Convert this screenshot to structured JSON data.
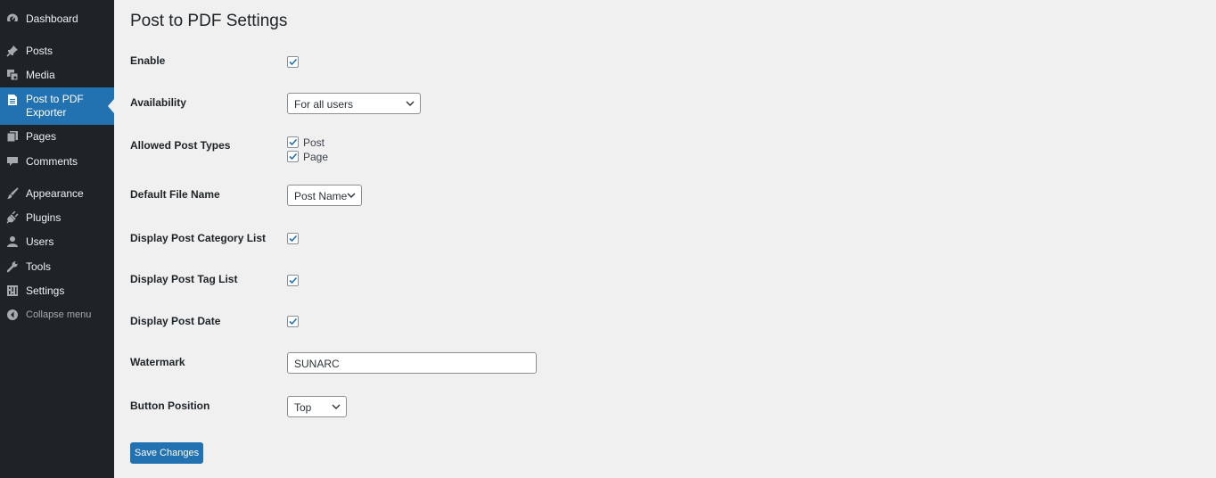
{
  "sidebar": {
    "items": [
      {
        "label": "Dashboard",
        "icon": "dashboard-icon"
      },
      {
        "label": "Posts",
        "icon": "pin-icon"
      },
      {
        "label": "Media",
        "icon": "media-icon"
      },
      {
        "label": "Post to PDF Exporter",
        "icon": "document-icon",
        "active": true
      },
      {
        "label": "Pages",
        "icon": "pages-icon"
      },
      {
        "label": "Comments",
        "icon": "comment-icon"
      },
      {
        "label": "Appearance",
        "icon": "brush-icon"
      },
      {
        "label": "Plugins",
        "icon": "plugin-icon"
      },
      {
        "label": "Users",
        "icon": "user-icon"
      },
      {
        "label": "Tools",
        "icon": "wrench-icon"
      },
      {
        "label": "Settings",
        "icon": "settings-icon"
      },
      {
        "label": "Collapse menu",
        "icon": "collapse-icon"
      }
    ]
  },
  "page": {
    "title": "Post to PDF Settings"
  },
  "settings": {
    "enable": {
      "label": "Enable",
      "checked": true
    },
    "availability": {
      "label": "Availability",
      "value": "For all users"
    },
    "allowed_post_types": {
      "label": "Allowed Post Types",
      "options": [
        {
          "label": "Post",
          "checked": true
        },
        {
          "label": "Page",
          "checked": true
        }
      ]
    },
    "default_file_name": {
      "label": "Default File Name",
      "value": "Post Name"
    },
    "display_post_category_list": {
      "label": "Display Post Category List",
      "checked": true
    },
    "display_post_tag_list": {
      "label": "Display Post Tag List",
      "checked": true
    },
    "display_post_date": {
      "label": "Display Post Date",
      "checked": true
    },
    "watermark": {
      "label": "Watermark",
      "value": "SUNARC"
    },
    "button_position": {
      "label": "Button Position",
      "value": "Top"
    }
  },
  "actions": {
    "save_label": "Save Changes"
  },
  "colors": {
    "sidebar_bg": "#1d2327",
    "accent": "#2271b1",
    "page_bg": "#f0f0f1"
  }
}
